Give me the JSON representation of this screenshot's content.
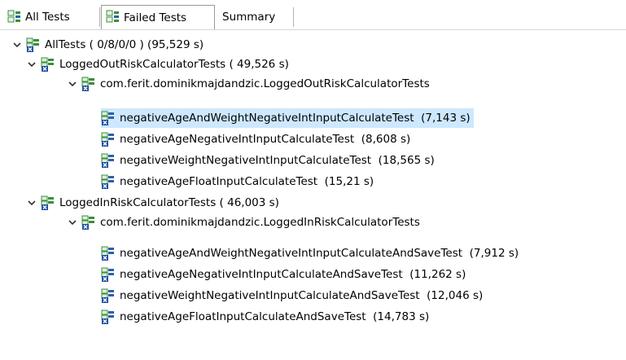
{
  "tabs": [
    {
      "label": "All Tests"
    },
    {
      "label": "Failed Tests"
    },
    {
      "label": "Summary"
    }
  ],
  "tree": {
    "root": {
      "label": "AllTests ( 0/8/0/0 ) (95,529 s)"
    },
    "suite1": {
      "label": "LoggedOutRiskCalculatorTests ( 49,526 s)"
    },
    "pkg1": {
      "label": "com.ferit.dominikmajdandzic.LoggedOutRiskCalculatorTests"
    },
    "tests1": [
      {
        "label": "negativeAgeAndWeightNegativeIntInputCalculateTest  (7,143 s)"
      },
      {
        "label": "negativeAgeNegativeIntInputCalculateTest  (8,608 s)"
      },
      {
        "label": "negativeWeightNegativeIntInputCalculateTest  (18,565 s)"
      },
      {
        "label": "negativeAgeFloatInputCalculateTest  (15,21 s)"
      }
    ],
    "suite2": {
      "label": "LoggedInRiskCalculatorTests ( 46,003 s)"
    },
    "pkg2": {
      "label": "com.ferit.dominikmajdandzic.LoggedInRiskCalculatorTests"
    },
    "tests2": [
      {
        "label": "negativeAgeAndWeightNegativeIntInputCalculateAndSaveTest  (7,912 s)"
      },
      {
        "label": "negativeAgeNegativeIntInputCalculateAndSaveTest  (11,262 s)"
      },
      {
        "label": "negativeWeightNegativeIntInputCalculateAndSaveTest  (12,046 s)"
      },
      {
        "label": "negativeAgeFloatInputCalculateAndSaveTest  (14,783 s)"
      }
    ]
  },
  "icons": {
    "suite_failed": "junit-suite-failure-icon",
    "test_failed": "junit-test-failure-icon",
    "tab_icon": "junit-results-icon",
    "expand": "chevron-down-icon"
  },
  "colors": {
    "selection": "#cde8ff",
    "icon_green": "#3a8f3a",
    "icon_blue": "#2f5fa8",
    "failure_blue": "#1d4fa0"
  }
}
